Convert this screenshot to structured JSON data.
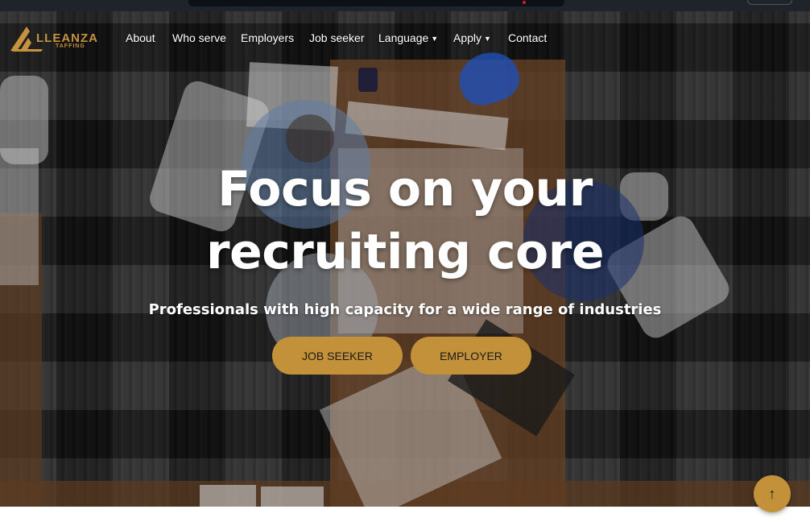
{
  "brand": {
    "name": "LLEANZA",
    "tagline": "TAFFING",
    "accent": "#c3913a",
    "logo_icon": "triangle-a-logo-icon"
  },
  "nav": {
    "items": [
      {
        "label": "About",
        "has_dropdown": false
      },
      {
        "label": "Who serve",
        "has_dropdown": false
      },
      {
        "label": "Employers",
        "has_dropdown": false
      },
      {
        "label": "Job seeker",
        "has_dropdown": false
      },
      {
        "label": "Language",
        "has_dropdown": true
      },
      {
        "label": "Apply",
        "has_dropdown": true
      },
      {
        "label": "Contact",
        "has_dropdown": false
      }
    ],
    "caret_icon": "chevron-down-icon"
  },
  "hero": {
    "title_line1": "Focus on your",
    "title_line2": "recruiting core",
    "subtitle": "Professionals with high capacity for a wide range of industries",
    "buttons": {
      "job_seeker": "JOB SEEKER",
      "employer": "EMPLOYER"
    },
    "background": "office meeting table viewed from above"
  },
  "scroll_top": {
    "icon": "arrow-up-icon",
    "glyph": "↑"
  }
}
